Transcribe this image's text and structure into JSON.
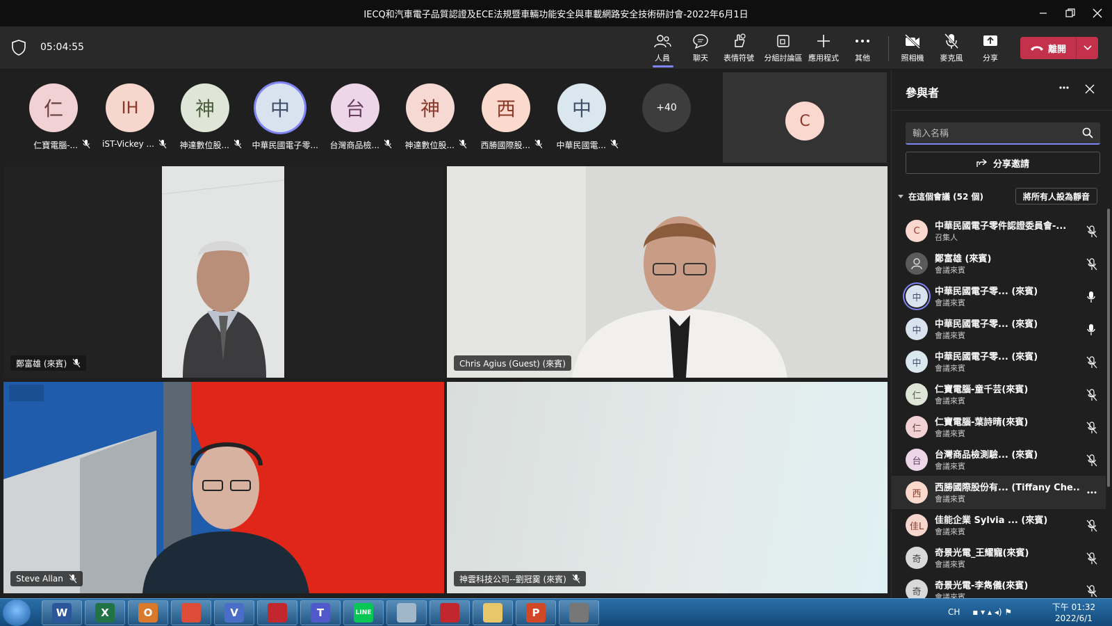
{
  "window": {
    "title": "IECQ和汽車電子品質認證及ECE法規暨車輛功能安全與車載網路安全技術研討會-2022年6月1日"
  },
  "toolbar": {
    "timer": "05:04:55",
    "buttons": [
      {
        "label": "人員",
        "icon": "people-icon"
      },
      {
        "label": "聊天",
        "icon": "chat-icon"
      },
      {
        "label": "表情符號",
        "icon": "reactions-icon"
      },
      {
        "label": "分組討論區",
        "icon": "breakout-rooms-icon"
      },
      {
        "label": "應用程式",
        "icon": "apps-icon"
      },
      {
        "label": "其他",
        "icon": "more-icon"
      },
      {
        "label": "照相機",
        "icon": "camera-off-icon"
      },
      {
        "label": "麥克風",
        "icon": "mic-off-icon"
      },
      {
        "label": "分享",
        "icon": "share-icon"
      }
    ],
    "leave_label": "離開",
    "accent": "#7f85f5",
    "leave_color": "#c4314b"
  },
  "roster": {
    "items": [
      {
        "initial": "仁",
        "name": "仁寶電腦-...",
        "bg": "#f1d1d3"
      },
      {
        "initial": "IH",
        "name": "iST-Vickey ...",
        "bg": "#f7d6cd"
      },
      {
        "initial": "神",
        "name": "神達數位股...",
        "bg": "#dfe6d8"
      },
      {
        "initial": "中",
        "name": "中華民國電子零...",
        "bg": "#d9e2ef"
      },
      {
        "initial": "台",
        "name": "台灣商品檢...",
        "bg": "#ecd6e8"
      },
      {
        "initial": "神",
        "name": "神達數位股...",
        "bg": "#f6d9d3"
      },
      {
        "initial": "西",
        "name": "西勝國際股...",
        "bg": "#fbd9cc"
      },
      {
        "initial": "中",
        "name": "中華民國電...",
        "bg": "#dbe7ee"
      }
    ],
    "more_count": "+40",
    "self_initial": "C"
  },
  "tiles": [
    {
      "name": "鄭富雄 (來賓)",
      "muted": true
    },
    {
      "name": "Chris Agius (Guest) (來賓)",
      "muted": false
    },
    {
      "name": "Steve Allan",
      "muted": true
    },
    {
      "name": "神雲科技公司--劉冠霙 (來賓)",
      "muted": true
    }
  ],
  "panel": {
    "title": "參與者",
    "search_placeholder": "輸入名稱",
    "share_invite": "分享邀請",
    "section_label": "在這個會議 (52 個)",
    "mute_all": "將所有人設為靜音",
    "participants": [
      {
        "initial": "C",
        "name": "中華民國電子零件認證委員會-...",
        "role": "召集人",
        "mic": "muted",
        "bg": "#fbd8cf",
        "fg": "#8b3a2a"
      },
      {
        "initial": "",
        "name": "鄭富雄 (來賓)",
        "role": "會議來賓",
        "mic": "muted",
        "bg": "#5a5a5a",
        "fg": "#ddd"
      },
      {
        "initial": "中",
        "name": "中華民國電子零... (來賓)",
        "role": "會議來賓",
        "mic": "on",
        "bg": "#d9e2ef",
        "fg": "#3e4f6a"
      },
      {
        "initial": "中",
        "name": "中華民國電子零... (來賓)",
        "role": "會議來賓",
        "mic": "on",
        "bg": "#d9e2ef",
        "fg": "#3e4f6a"
      },
      {
        "initial": "中",
        "name": "中華民國電子零... (來賓)",
        "role": "會議來賓",
        "mic": "muted",
        "bg": "#dbe7ee",
        "fg": "#3e4f6a"
      },
      {
        "initial": "仁",
        "name": "仁寶電腦-童千芸(來賓)",
        "role": "會議來賓",
        "mic": "muted",
        "bg": "#dfe6d8",
        "fg": "#4c5e3e"
      },
      {
        "initial": "仁",
        "name": "仁寶電腦-葉詩晴(來賓)",
        "role": "會議來賓",
        "mic": "muted",
        "bg": "#f1d1d3",
        "fg": "#6a3f3f"
      },
      {
        "initial": "台",
        "name": "台灣商品檢測驗... (來賓)",
        "role": "會議來賓",
        "mic": "muted",
        "bg": "#ecd6e8",
        "fg": "#6a3f62"
      },
      {
        "initial": "西",
        "name": "西勝國際股份有... (Tiffany Che...",
        "role": "會議來賓",
        "mic": "more",
        "bg": "#fbd9cc",
        "fg": "#8b3a2a"
      },
      {
        "initial": "佳L",
        "name": "佳能企業 Sylvia ... (來賓)",
        "role": "會議來賓",
        "mic": "muted",
        "bg": "#f7d6cd",
        "fg": "#8b3a2a"
      },
      {
        "initial": "奇",
        "name": "奇景光電_王耀寵(來賓)",
        "role": "會議來賓",
        "mic": "muted",
        "bg": "#d9d9d9",
        "fg": "#444"
      },
      {
        "initial": "奇",
        "name": "奇景光電-李雋儀(來賓)",
        "role": "會議來賓",
        "mic": "muted",
        "bg": "#d9d9d9",
        "fg": "#444"
      }
    ]
  },
  "taskbar": {
    "apps": [
      "W",
      "X",
      "O",
      "",
      "V",
      "",
      "T",
      "LINE",
      "",
      "",
      "",
      "P",
      ""
    ],
    "tray_lang": "CH",
    "time": "下午 01:32",
    "date": "2022/6/1"
  }
}
